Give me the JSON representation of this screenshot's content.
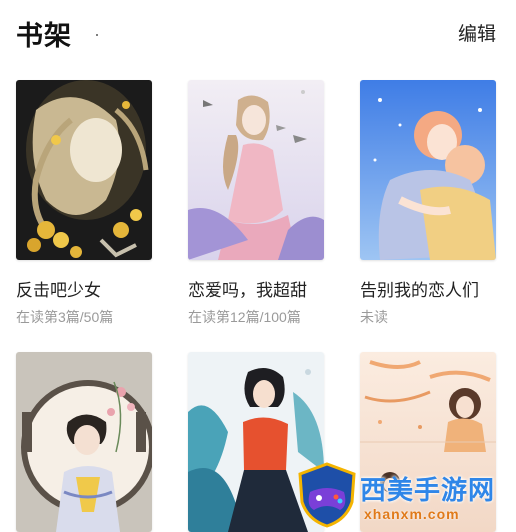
{
  "header": {
    "title": "书架",
    "edit_label": "编辑"
  },
  "books": [
    {
      "title": "反击吧少女",
      "progress": "在读第3篇/50篇"
    },
    {
      "title": "恋爱吗，我超甜",
      "progress": "在读第12篇/100篇"
    },
    {
      "title": "告别我的恋人们",
      "progress": "未读"
    },
    {
      "title": "",
      "progress": ""
    },
    {
      "title": "",
      "progress": ""
    },
    {
      "title": "",
      "progress": ""
    }
  ],
  "watermark": {
    "site_name": "西美手游网",
    "url": "xhanxm.com"
  },
  "colors": {
    "background": "#ffffff",
    "text": "#222222",
    "subtext": "#9a9a9a",
    "watermark_blue": "#2f86e8",
    "watermark_orange": "#e07a1a"
  }
}
